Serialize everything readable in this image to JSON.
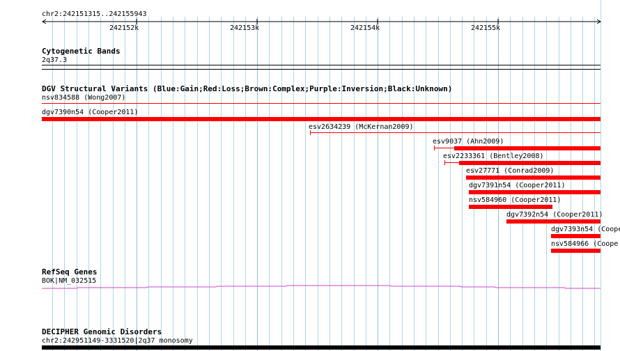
{
  "ruler": {
    "range_label": "chr2:242151315..242155943",
    "ticks": [
      "242152k",
      "242153k",
      "242154k",
      "242155k"
    ]
  },
  "tracks": {
    "cytoband": {
      "title": "Cytogenetic Bands",
      "band": "2q37.3"
    },
    "dgv": {
      "title": "DGV Structural Variants (Blue:Gain;Red:Loss;Brown:Complex;Purple:Inversion;Black:Unknown)",
      "features": [
        {
          "label": "nsv834588 (Wong2007)"
        },
        {
          "label": "dgv7390n54 (Cooper2011)"
        },
        {
          "label": "esv2634239 (McKernan2009)"
        },
        {
          "label": "esv9037 (Ahn2009)"
        },
        {
          "label": "esv2233361 (Bentley2008)"
        },
        {
          "label": "esv27771 (Conrad2009)"
        },
        {
          "label": "dgv7391n54 (Cooper2011)"
        },
        {
          "label": "nsv584960 (Cooper2011)"
        },
        {
          "label": "dgv7392n54 (Cooper2011)"
        },
        {
          "label": "dgv7393n54 (Coope"
        },
        {
          "label": "nsv584966 (Coope"
        }
      ]
    },
    "refseq": {
      "title": "RefSeq Genes",
      "gene": "BOK|NM_032515"
    },
    "decipher": {
      "title": "DECIPHER Genomic Disorders",
      "feature": "chr2:242951149-3331520|2q37 monosomy"
    }
  },
  "colors": {
    "loss": "#ff0000",
    "gene": "#cc44cc",
    "grid": "#add8e6"
  }
}
